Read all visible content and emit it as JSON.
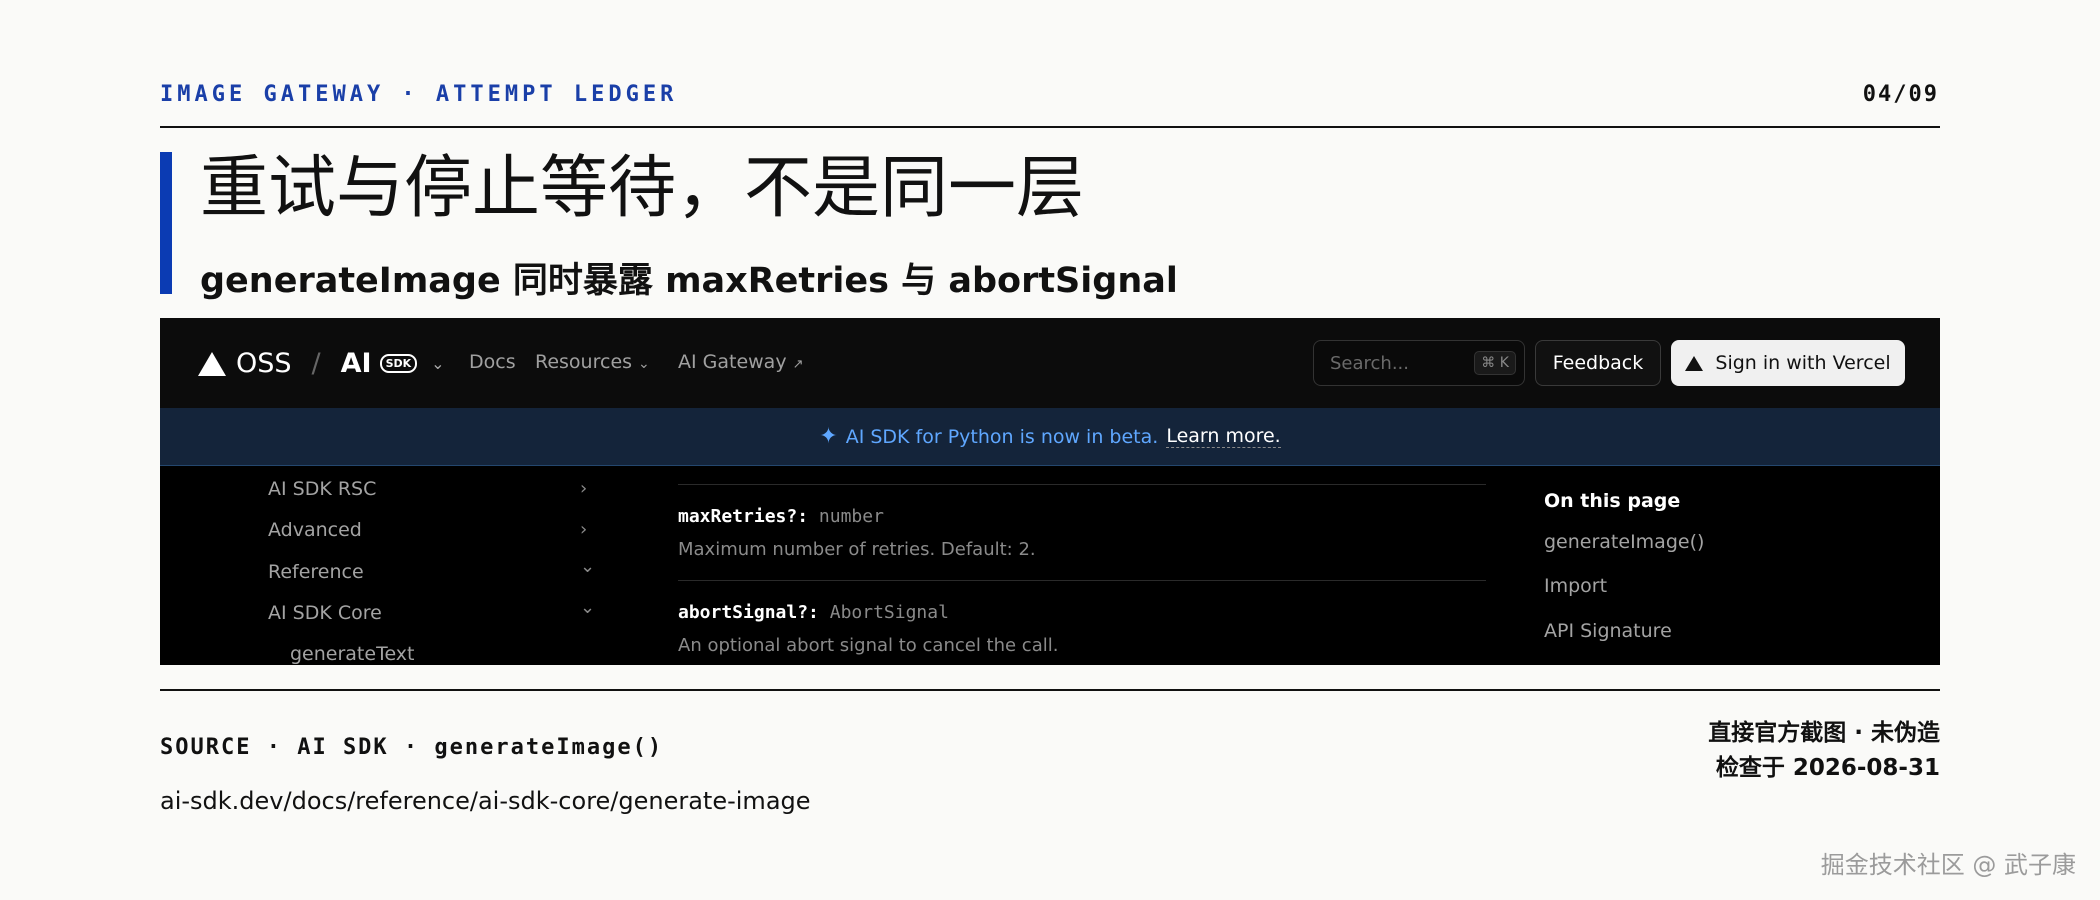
{
  "header": {
    "eyebrow": "IMAGE GATEWAY · ATTEMPT LEDGER",
    "page": "04/09"
  },
  "title": "重试与停止等待，不是同一层",
  "subtitle": "generateImage 同时暴露 maxRetries 与 abortSignal",
  "screenshot": {
    "nav": {
      "brand_oss": "OSS",
      "brand_sep": "/",
      "brand_ai": "AI",
      "brand_pill": "SDK",
      "links": [
        "Docs",
        "Resources",
        "AI Gateway"
      ],
      "search_placeholder": "Search...",
      "search_shortcut": "⌘ K",
      "feedback": "Feedback",
      "signin": "Sign in with Vercel"
    },
    "banner": {
      "text": "AI SDK for Python is now in beta.",
      "link": "Learn more."
    },
    "sidebar": {
      "items": [
        {
          "label": "AI SDK RSC",
          "chevron": "›"
        },
        {
          "label": "Advanced",
          "chevron": "›"
        },
        {
          "label": "Reference",
          "chevron": "⌄"
        },
        {
          "label": "AI SDK Core",
          "chevron": "⌄"
        },
        {
          "label": "generateText",
          "chevron": ""
        }
      ]
    },
    "params": [
      {
        "name": "maxRetries?:",
        "type": "number",
        "desc": "Maximum number of retries. Default: 2."
      },
      {
        "name": "abortSignal?:",
        "type": "AbortSignal",
        "desc": "An optional abort signal to cancel the call."
      }
    ],
    "toc": {
      "title": "On this page",
      "items": [
        "generateImage()",
        "Import",
        "API Signature"
      ]
    }
  },
  "footer": {
    "source": "SOURCE · AI SDK · generateImage()",
    "url": "ai-sdk.dev/docs/reference/ai-sdk-core/generate-image",
    "note1": "直接官方截图 · 未伪造",
    "note2": "检查于 2026-08-31"
  },
  "watermark": "掘金技术社区 @ 武子康",
  "colors": {
    "accent": "#0b3bb3",
    "eyebrow": "#1a3fa8",
    "banner_text": "#5fa7ff"
  }
}
